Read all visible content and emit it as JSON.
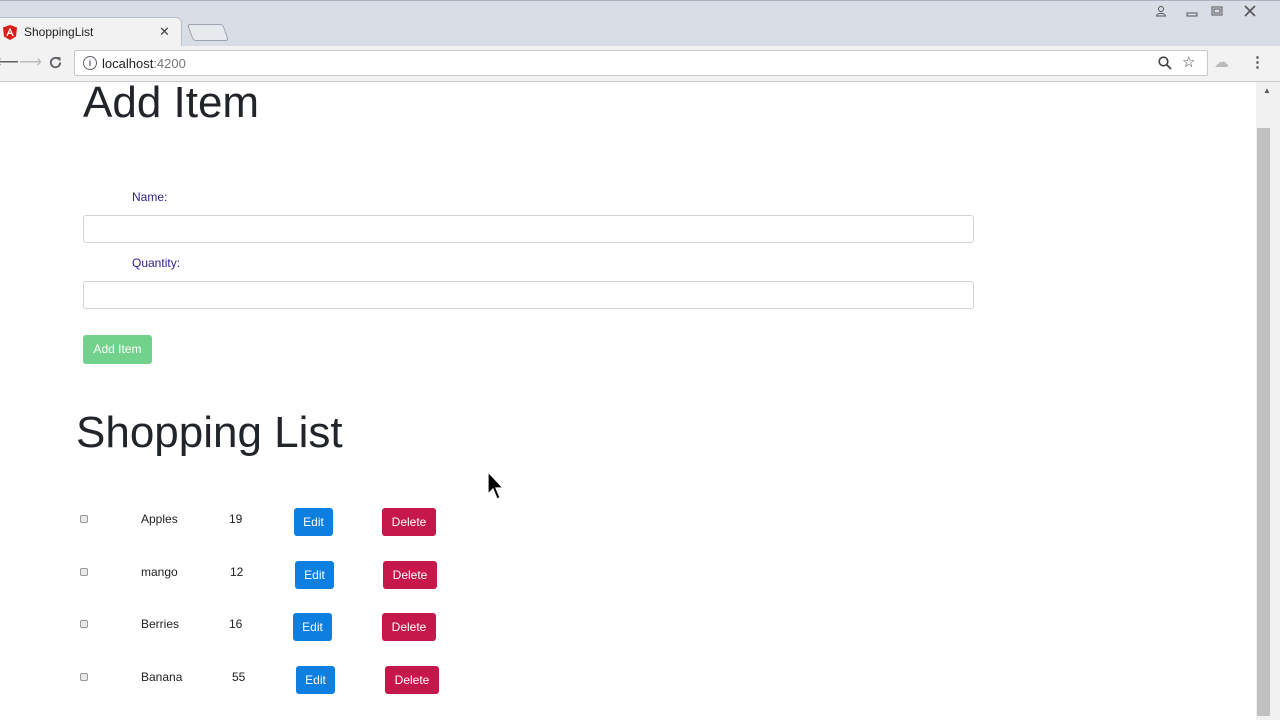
{
  "browser": {
    "tab_title": "ShoppingList",
    "tab_close": "✕",
    "url_host": "localhost",
    "url_port": ":4200",
    "icons": [
      "back-icon",
      "forward-icon",
      "reload-icon",
      "info-icon",
      "zoom-icon",
      "star-icon",
      "extension-icon",
      "menu-icon"
    ]
  },
  "page": {
    "add_title": "Add Item",
    "name_label": "Name:",
    "name_value": "",
    "quantity_label": "Quantity:",
    "quantity_value": "",
    "add_button": "Add Item",
    "list_title": "Shopping List",
    "edit_label": "Edit",
    "delete_label": "Delete",
    "items": [
      {
        "name": "Apples",
        "quantity": "19"
      },
      {
        "name": "mango",
        "quantity": "12"
      },
      {
        "name": "Berries",
        "quantity": "16"
      },
      {
        "name": "Banana",
        "quantity": "55"
      }
    ]
  },
  "colors": {
    "edit_button": "#0d7fe0",
    "delete_button": "#c5174a",
    "add_button_disabled": "#72d18b",
    "label_text": "#2b1f8a"
  }
}
